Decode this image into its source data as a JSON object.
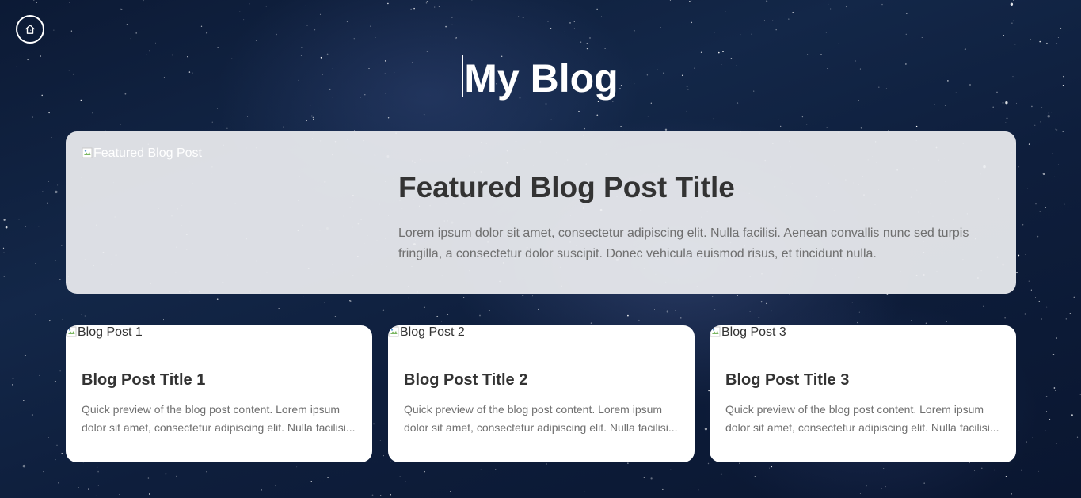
{
  "header": {
    "home_icon": "home-icon",
    "title": "My Blog"
  },
  "featured": {
    "image_alt": "Featured Blog Post",
    "title": "Featured Blog Post Title",
    "text": "Lorem ipsum dolor sit amet, consectetur adipiscing elit. Nulla facilisi. Aenean convallis nunc sed turpis fringilla, a consectetur dolor suscipit. Donec vehicula euismod risus, et tincidunt nulla."
  },
  "posts": [
    {
      "image_alt": "Blog Post 1",
      "title": "Blog Post Title 1",
      "preview": "Quick preview of the blog post content. Lorem ipsum dolor sit amet, consectetur adipiscing elit. Nulla facilisi..."
    },
    {
      "image_alt": "Blog Post 2",
      "title": "Blog Post Title 2",
      "preview": "Quick preview of the blog post content. Lorem ipsum dolor sit amet, consectetur adipiscing elit. Nulla facilisi..."
    },
    {
      "image_alt": "Blog Post 3",
      "title": "Blog Post Title 3",
      "preview": "Quick preview of the blog post content. Lorem ipsum dolor sit amet, consectetur adipiscing elit. Nulla facilisi..."
    }
  ],
  "colors": {
    "title_text": "#ffffff",
    "heading_text": "#333333",
    "body_text": "#6f6f6f",
    "card_bg": "#ffffff",
    "background": "#0e1e3c"
  }
}
